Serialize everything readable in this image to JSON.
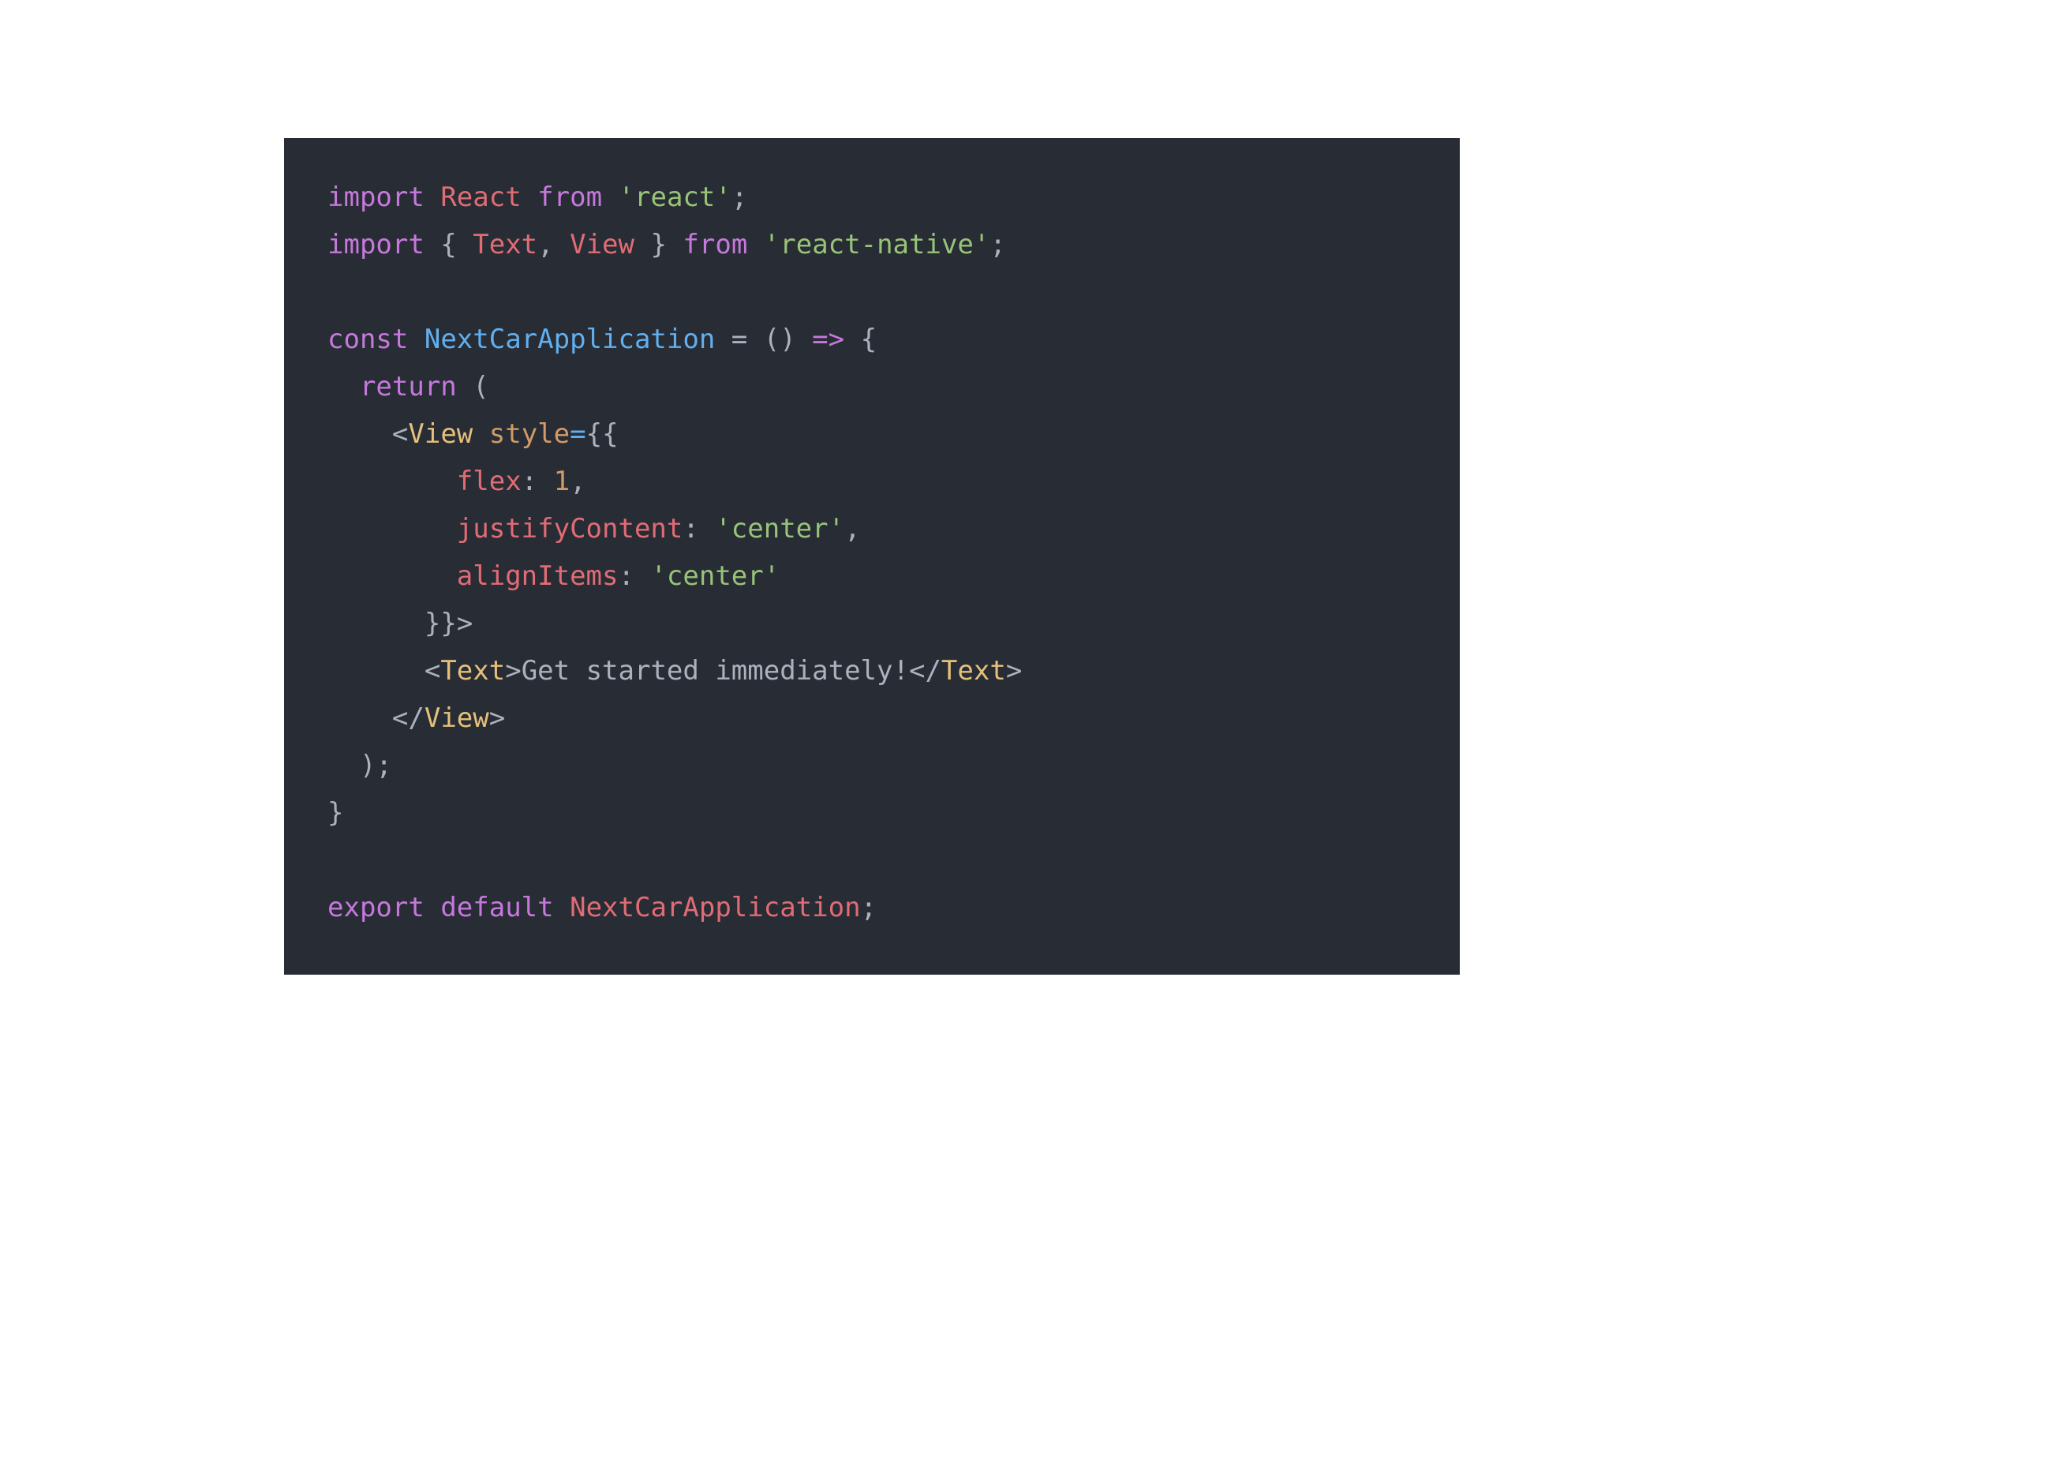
{
  "code": {
    "lines": [
      {
        "tokens": [
          {
            "cls": "tok-keyword",
            "t": "import"
          },
          {
            "cls": "tok-punct",
            "t": " "
          },
          {
            "cls": "tok-red",
            "t": "React"
          },
          {
            "cls": "tok-punct",
            "t": " "
          },
          {
            "cls": "tok-keyword",
            "t": "from"
          },
          {
            "cls": "tok-punct",
            "t": " "
          },
          {
            "cls": "tok-string",
            "t": "'react'"
          },
          {
            "cls": "tok-punct",
            "t": ";"
          }
        ]
      },
      {
        "tokens": [
          {
            "cls": "tok-keyword",
            "t": "import"
          },
          {
            "cls": "tok-punct",
            "t": " { "
          },
          {
            "cls": "tok-red",
            "t": "Text"
          },
          {
            "cls": "tok-punct",
            "t": ", "
          },
          {
            "cls": "tok-red",
            "t": "View"
          },
          {
            "cls": "tok-punct",
            "t": " } "
          },
          {
            "cls": "tok-keyword",
            "t": "from"
          },
          {
            "cls": "tok-punct",
            "t": " "
          },
          {
            "cls": "tok-string",
            "t": "'react-native'"
          },
          {
            "cls": "tok-punct",
            "t": ";"
          }
        ]
      },
      {
        "tokens": [
          {
            "cls": "tok-punct",
            "t": ""
          }
        ]
      },
      {
        "tokens": [
          {
            "cls": "tok-keyword",
            "t": "const"
          },
          {
            "cls": "tok-punct",
            "t": " "
          },
          {
            "cls": "tok-func",
            "t": "NextCarApplication"
          },
          {
            "cls": "tok-punct",
            "t": " = () "
          },
          {
            "cls": "tok-keyword",
            "t": "=>"
          },
          {
            "cls": "tok-punct",
            "t": " {"
          }
        ]
      },
      {
        "tokens": [
          {
            "cls": "guide",
            "t": "  "
          },
          {
            "cls": "tok-keyword",
            "t": "return"
          },
          {
            "cls": "tok-punct",
            "t": " ("
          }
        ]
      },
      {
        "tokens": [
          {
            "cls": "guide",
            "t": "    "
          },
          {
            "cls": "tok-punct",
            "t": "<"
          },
          {
            "cls": "tok-class",
            "t": "View"
          },
          {
            "cls": "tok-punct",
            "t": " "
          },
          {
            "cls": "tok-attr",
            "t": "style"
          },
          {
            "cls": "tok-func",
            "t": "="
          },
          {
            "cls": "tok-punct",
            "t": "{{"
          }
        ]
      },
      {
        "tokens": [
          {
            "cls": "guide",
            "t": "      "
          },
          {
            "cls": "tok-punct",
            "t": "  "
          },
          {
            "cls": "tok-red",
            "t": "flex"
          },
          {
            "cls": "tok-punct",
            "t": ": "
          },
          {
            "cls": "tok-attr",
            "t": "1"
          },
          {
            "cls": "tok-punct",
            "t": ","
          }
        ]
      },
      {
        "tokens": [
          {
            "cls": "guide",
            "t": "      "
          },
          {
            "cls": "tok-punct",
            "t": "  "
          },
          {
            "cls": "tok-red",
            "t": "justifyContent"
          },
          {
            "cls": "tok-punct",
            "t": ": "
          },
          {
            "cls": "tok-string",
            "t": "'center'"
          },
          {
            "cls": "tok-punct",
            "t": ","
          }
        ]
      },
      {
        "tokens": [
          {
            "cls": "guide",
            "t": "      "
          },
          {
            "cls": "tok-punct",
            "t": "  "
          },
          {
            "cls": "tok-red",
            "t": "alignItems"
          },
          {
            "cls": "tok-punct",
            "t": ": "
          },
          {
            "cls": "tok-string",
            "t": "'center'"
          }
        ]
      },
      {
        "tokens": [
          {
            "cls": "guide",
            "t": "      "
          },
          {
            "cls": "tok-punct",
            "t": "}}>"
          }
        ]
      },
      {
        "tokens": [
          {
            "cls": "guide",
            "t": "      "
          },
          {
            "cls": "tok-punct",
            "t": "<"
          },
          {
            "cls": "tok-class",
            "t": "Text"
          },
          {
            "cls": "tok-punct",
            "t": ">"
          },
          {
            "cls": "tok-text",
            "t": "Get started immediately!"
          },
          {
            "cls": "tok-punct",
            "t": "</"
          },
          {
            "cls": "tok-class",
            "t": "Text"
          },
          {
            "cls": "tok-punct",
            "t": ">"
          }
        ]
      },
      {
        "tokens": [
          {
            "cls": "guide",
            "t": "    "
          },
          {
            "cls": "tok-punct",
            "t": "</"
          },
          {
            "cls": "tok-class",
            "t": "View"
          },
          {
            "cls": "tok-punct",
            "t": ">"
          }
        ]
      },
      {
        "tokens": [
          {
            "cls": "guide",
            "t": "  "
          },
          {
            "cls": "tok-punct",
            "t": ");"
          }
        ]
      },
      {
        "tokens": [
          {
            "cls": "tok-punct",
            "t": "}"
          }
        ]
      },
      {
        "tokens": [
          {
            "cls": "tok-punct",
            "t": ""
          }
        ]
      },
      {
        "tokens": [
          {
            "cls": "tok-keyword",
            "t": "export"
          },
          {
            "cls": "tok-punct",
            "t": " "
          },
          {
            "cls": "tok-keyword",
            "t": "default"
          },
          {
            "cls": "tok-punct",
            "t": " "
          },
          {
            "cls": "tok-red",
            "t": "NextCarApplication"
          },
          {
            "cls": "tok-punct",
            "t": ";"
          }
        ]
      }
    ]
  }
}
